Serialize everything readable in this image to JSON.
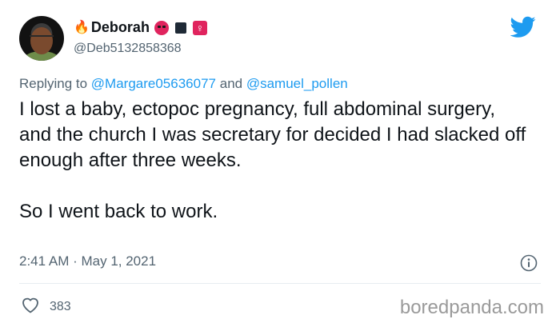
{
  "tweet": {
    "display_name": "Deborah",
    "handle": "@Deb5132858368",
    "replying_prefix": "Replying to",
    "replying_users": [
      "@Margare05636077",
      "@samuel_pollen"
    ],
    "replying_joiner": "and",
    "body": "I lost a baby, ectopoc pregnancy, full abdominal surgery, and the church I was secretary for decided I had slacked off enough after three weeks.\n\nSo I went back to work.",
    "timestamp": "2:41 AM · May 1, 2021",
    "likes": "383"
  },
  "icons": {
    "name_emojis": [
      "fire-emoji",
      "angry-face-emoji",
      "black-square-emoji",
      "female-sign-emoji"
    ],
    "brand": "twitter-bird-icon",
    "info": "info-icon",
    "like": "heart-icon"
  },
  "watermark": "boredpanda.com",
  "colors": {
    "twitter_blue": "#1d9bf0",
    "secondary_text": "#536471",
    "angry_red": "#e0245e"
  }
}
